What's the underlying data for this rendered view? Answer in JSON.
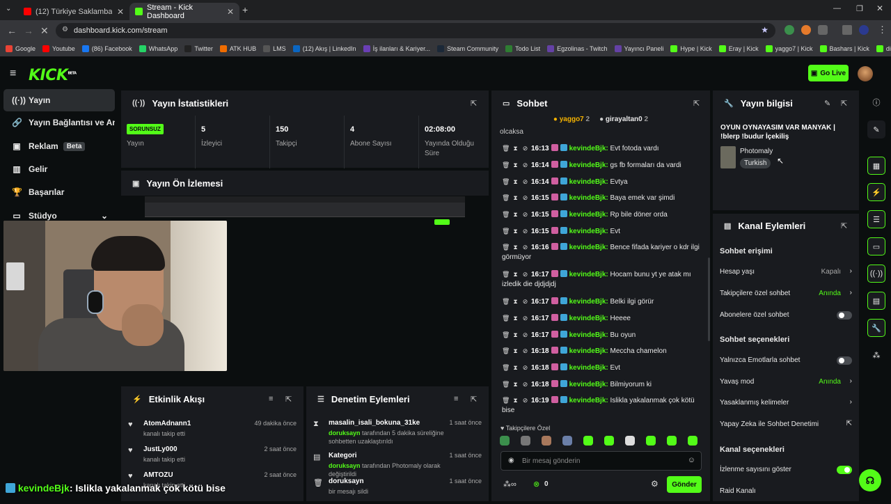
{
  "browser": {
    "tabs": [
      {
        "title": "(12) Türkiye Saklambaçta Yarışı",
        "active": false
      },
      {
        "title": "Stream - Kick Dashboard",
        "active": true
      }
    ],
    "url": "dashboard.kick.com/stream",
    "bookmarks": [
      "Google",
      "Youtube",
      "(86) Facebook",
      "WhatsApp",
      "Twitter",
      "ATK HUB",
      "LMS",
      "(12) Akış | LinkedIn",
      "İş ilanları & Kariyer...",
      "Steam Community",
      "Todo List",
      "Egzolinas - Twitch",
      "Yayıncı Paneli",
      "Hype | Kick",
      "Eray | Kick",
      "yaggo7 | Kick",
      "Bashars | Kick",
      "dirim | Kick"
    ]
  },
  "header": {
    "logo": "KICK",
    "logo_sup": "BETA",
    "go_live": "Go Live"
  },
  "sidebar": {
    "items": [
      {
        "label": "Yayın",
        "icon": "broadcast-icon"
      },
      {
        "label": "Yayın Bağlantısı ve Anahtar",
        "icon": "link-icon"
      },
      {
        "label": "Reklam",
        "icon": "ad-icon",
        "badge": "Beta"
      },
      {
        "label": "Gelir",
        "icon": "revenue-icon"
      },
      {
        "label": "Başarılar",
        "icon": "trophy-icon"
      },
      {
        "label": "Stüdyo",
        "icon": "studio-icon"
      }
    ]
  },
  "stats": {
    "title": "Yayın İstatistikleri",
    "status_badge": "SORUNSUZ",
    "items": [
      {
        "value": "",
        "label": "Yayın"
      },
      {
        "value": "5",
        "label": "İzleyici"
      },
      {
        "value": "150",
        "label": "Takipçi"
      },
      {
        "value": "4",
        "label": "Abone Sayısı"
      },
      {
        "value": "02:08:00",
        "label": "Yayında Olduğu Süre"
      }
    ]
  },
  "preview": {
    "title": "Yayın Ön İzlemesi"
  },
  "activity": {
    "title": "Etkinlik Akışı",
    "items": [
      {
        "name": "AtomAdnann1",
        "sub": "kanalı takip etti",
        "when": "49 dakika önce"
      },
      {
        "name": "JustLy000",
        "sub": "kanalı takip etti",
        "when": "2 saat önce"
      },
      {
        "name": "AMTOZU",
        "sub": "kanalı takip etti",
        "when": "2 saat önce"
      }
    ]
  },
  "moderation": {
    "title": "Denetim Eylemleri",
    "items": [
      {
        "name": "masalin_isali_bokuna_31ke",
        "actor": "doruksayn",
        "text": "tarafından 5 dakika süreliğine sohbetten uzaklaştırıldı",
        "when": "1 saat önce"
      },
      {
        "name": "Kategori",
        "actor": "doruksayn",
        "text": "tarafından Photomaly olarak değiştirildi",
        "when": "1 saat önce"
      },
      {
        "name": "doruksayn",
        "actor": "",
        "text": "bir mesajı sildi",
        "when": "1 saat önce"
      }
    ]
  },
  "chat": {
    "title": "Sohbet",
    "top_users": [
      {
        "name": "yaggo7",
        "count": "2"
      },
      {
        "name": "girayaltan0",
        "count": "2"
      }
    ],
    "partial_top": "olcaksa",
    "messages": [
      {
        "time": "16:13",
        "user": "kevindeBjk",
        "text": "Evt fotoda vardı"
      },
      {
        "time": "16:14",
        "user": "kevindeBjk",
        "text": "gs fb formaları da vardi"
      },
      {
        "time": "16:14",
        "user": "kevindeBjk",
        "text": "Evtya"
      },
      {
        "time": "16:15",
        "user": "kevindeBjk",
        "text": "Baya emek var şimdi"
      },
      {
        "time": "16:15",
        "user": "kevindeBjk",
        "text": "Rp bile döner orda"
      },
      {
        "time": "16:15",
        "user": "kevindeBjk",
        "text": "Evt"
      },
      {
        "time": "16:16",
        "user": "kevindeBjk",
        "text": "Bence fifada kariyer o kdr ilgi görmüyor"
      },
      {
        "time": "16:17",
        "user": "kevindeBjk",
        "text": "Hocam bunu yt ye atak mı izledik die djdjdjdj"
      },
      {
        "time": "16:17",
        "user": "kevindeBjk",
        "text": "Belki ilgi görür"
      },
      {
        "time": "16:17",
        "user": "kevindeBjk",
        "text": "Heeee"
      },
      {
        "time": "16:17",
        "user": "kevindeBjk",
        "text": "Bu oyun"
      },
      {
        "time": "16:18",
        "user": "kevindeBjk",
        "text": "Meccha chamelon"
      },
      {
        "time": "16:18",
        "user": "kevindeBjk",
        "text": "Evt"
      },
      {
        "time": "16:18",
        "user": "kevindeBjk",
        "text": "Bilmiyorum ki"
      },
      {
        "time": "16:19",
        "user": "kevindeBjk",
        "text": "Islikla yakalanmak çok kötü bise"
      }
    ],
    "followers_only": "Takipçilere Özel",
    "input_placeholder": "Bir mesaj gönderin",
    "points": "0",
    "send": "Gönder"
  },
  "info": {
    "title": "Yayın bilgisi",
    "stream_title": "OYUN OYNAYASIM VAR MANYAK | !blerp !budur İçekiliş",
    "category": "Photomaly",
    "language": "Turkish"
  },
  "channel": {
    "title": "Kanal Eylemleri",
    "chat_access": "Sohbet erişimi",
    "rows1": [
      {
        "label": "Hesap yaşı",
        "value": "Kapalı"
      },
      {
        "label": "Takipçilere özel sohbet",
        "value": "Anında"
      },
      {
        "label": "Abonelere özel sohbet",
        "value": ""
      }
    ],
    "chat_options": "Sohbet seçenekleri",
    "rows2": [
      {
        "label": "Yalnızca Emotlarla sohbet",
        "value": ""
      },
      {
        "label": "Yavaş mod",
        "value": "Anında"
      },
      {
        "label": "Yasaklanmış kelimeler",
        "value": ""
      },
      {
        "label": "Yapay Zeka ile Sohbet Denetimi",
        "value": ""
      }
    ],
    "channel_options": "Kanal seçenekleri",
    "rows3": [
      {
        "label": "İzlenme sayısını göster",
        "value": ""
      },
      {
        "label": "Raid Kanalı",
        "value": ""
      }
    ]
  },
  "overlay": {
    "user": "kevindeBjk",
    "text": ": Islikla yakalanmak çok kötü bise"
  }
}
